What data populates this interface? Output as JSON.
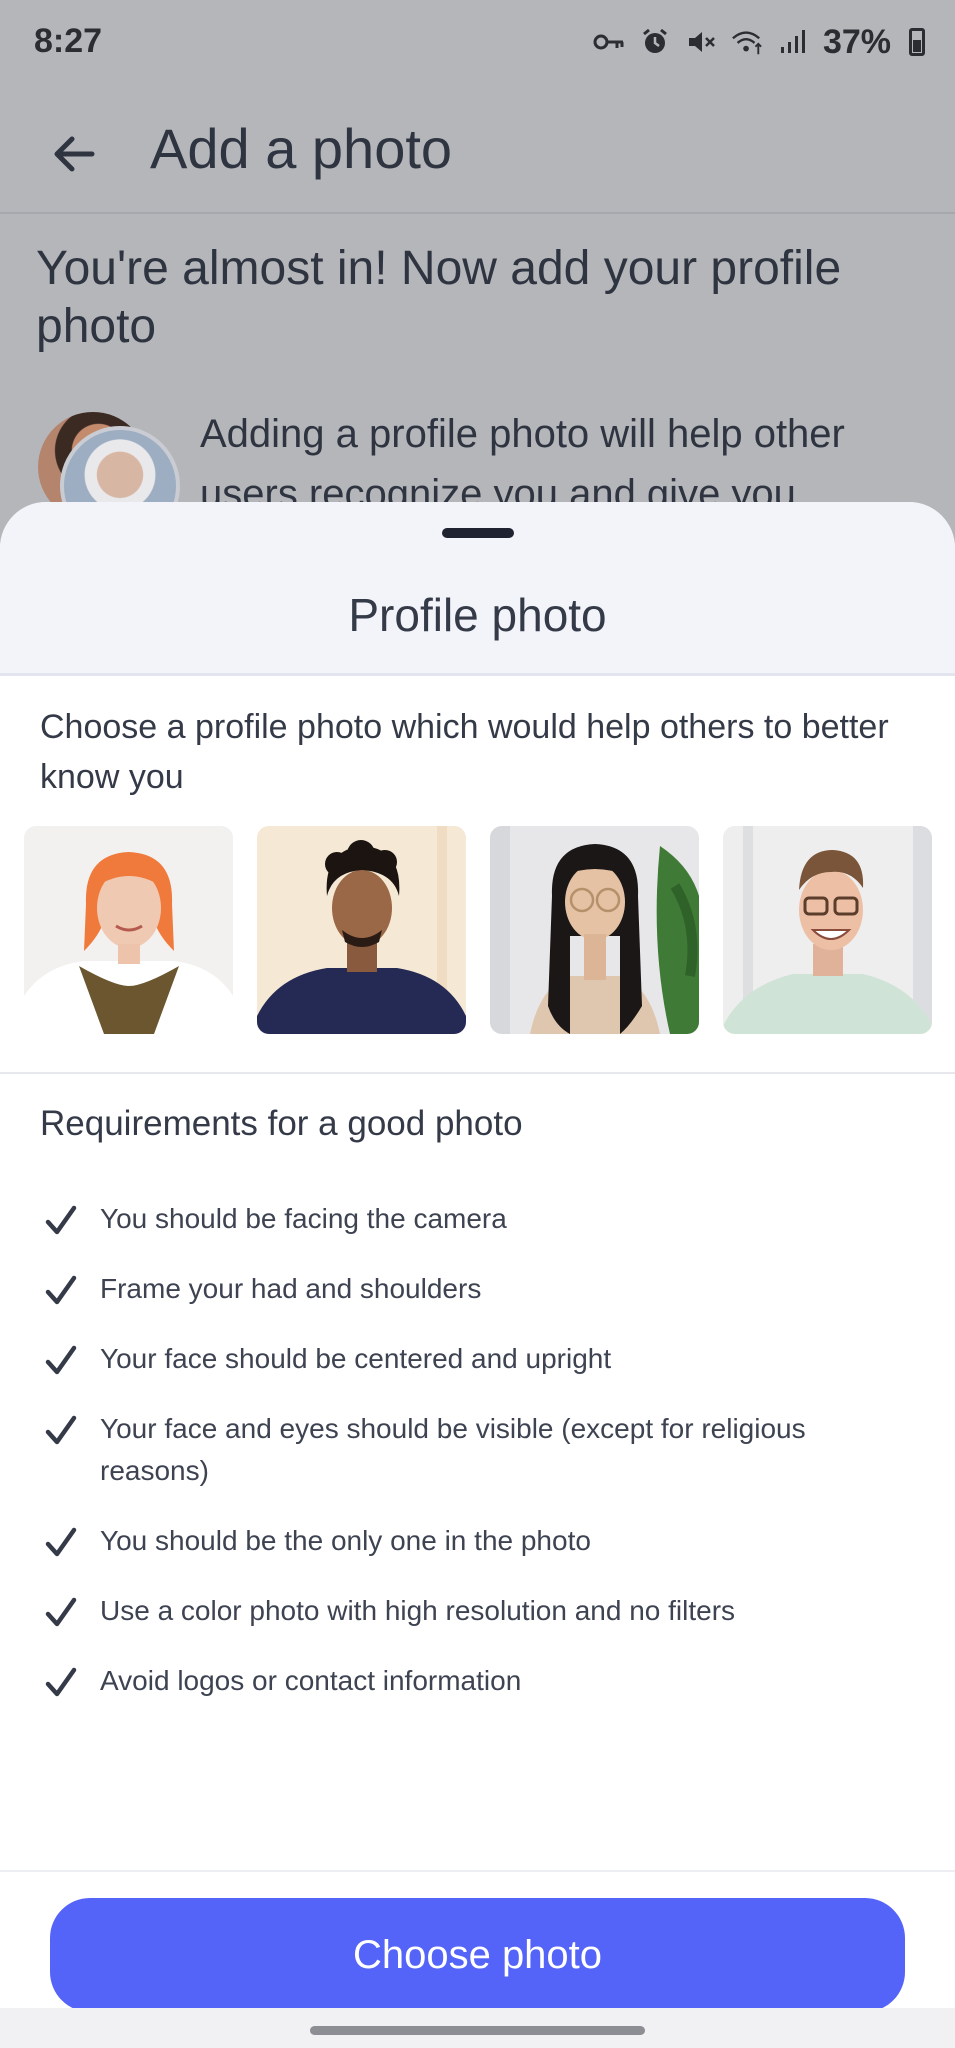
{
  "status_bar": {
    "time": "8:27",
    "battery": "37%",
    "icons": [
      "vpn-key-icon",
      "alarm-icon",
      "mute-icon",
      "wifi-icon",
      "signal-icon",
      "battery-icon"
    ]
  },
  "app_bar": {
    "title": "Add a photo",
    "back_icon": "arrow-left-icon"
  },
  "background": {
    "heading": "You're almost in! Now add your profile photo",
    "text": "Adding a profile photo will help other users recognize you and give you"
  },
  "sheet": {
    "title": "Profile photo",
    "intro": "Choose a profile photo which would help others to better know you",
    "example_photos": [
      "woman-orange-hair-photo",
      "man-curly-hair-photo",
      "woman-glasses-photo",
      "man-glasses-photo"
    ],
    "requirements_title": "Requirements for a good photo",
    "requirements": [
      "You should be facing the camera",
      "Frame your had and shoulders",
      "Your face should be centered and upright",
      "Your face and eyes should be visible (except for religious reasons)",
      "You should be the only one in the photo",
      "Use a color photo with high resolution and no filters",
      "Avoid logos or contact information"
    ],
    "cta_label": "Choose photo"
  },
  "colors": {
    "accent": "#5463f8",
    "text": "#353a48",
    "scrim": "#b5b6ba"
  }
}
